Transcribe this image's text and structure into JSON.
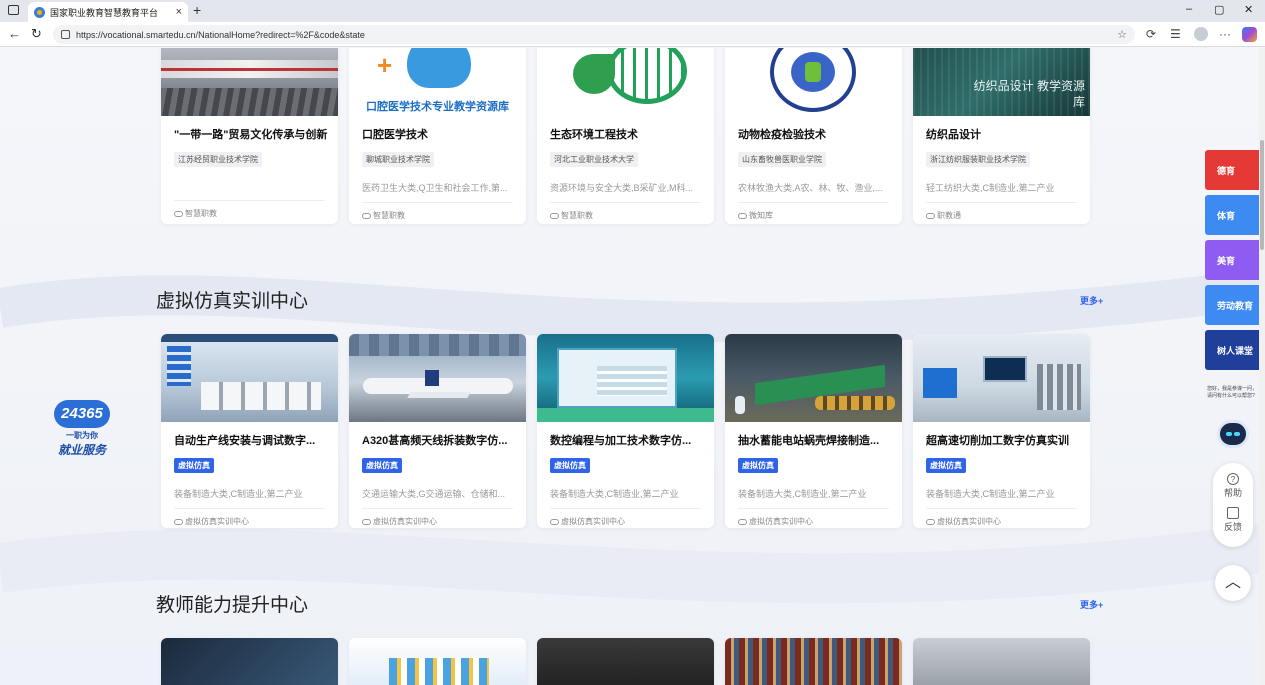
{
  "browser": {
    "tab_title": "国家职业教育智慧教育平台",
    "tab_close": "×",
    "new_tab": "+",
    "url": "https://vocational.smartedu.cn/NationalHome?redirect=%2F&code&state",
    "back": "←",
    "reload": "↻",
    "minimize": "–",
    "maximize": "▢",
    "close": "✕",
    "star": "☆",
    "more": "···"
  },
  "top_cards": [
    {
      "title": "\"一带一路\"贸易文化传承与创新",
      "school": "江苏经贸职业技术学院",
      "category": "",
      "source": "智慧职教"
    },
    {
      "title": "口腔医学技术",
      "school": "聊城职业技术学院",
      "category": "医药卫生大类,Q卫生和社会工作,第...",
      "source": "智慧职教",
      "thumb_text": "口腔医学技术专业教学资源库"
    },
    {
      "title": "生态环境工程技术",
      "school": "河北工业职业技术大学",
      "category": "资源环境与安全大类,B采矿业,M科...",
      "source": "智慧职教"
    },
    {
      "title": "动物检疫检验技术",
      "school": "山东畜牧兽医职业学院",
      "category": "农林牧渔大类,A农、林、牧、渔业,...",
      "source": "微知库"
    },
    {
      "title": "纺织品设计",
      "school": "浙江纺织服装职业技术学院",
      "category": "轻工纺织大类,C制造业,第二产业",
      "source": "职教通",
      "thumb_text": "纺织品设计 教学资源库"
    }
  ],
  "virtual_section": {
    "title": "虚拟仿真实训中心",
    "more": "更多+",
    "cards": [
      {
        "title": "自动生产线安装与调试数字...",
        "badge": "虚拟仿真",
        "category": "装备制造大类,C制造业,第二产业",
        "source": "虚拟仿真实训中心"
      },
      {
        "title": "A320甚高频天线拆装数字仿...",
        "badge": "虚拟仿真",
        "category": "交通运输大类,G交通运输、仓储和...",
        "source": "虚拟仿真实训中心"
      },
      {
        "title": "数控编程与加工技术数字仿...",
        "badge": "虚拟仿真",
        "category": "装备制造大类,C制造业,第二产业",
        "source": "虚拟仿真实训中心"
      },
      {
        "title": "抽水蓄能电站蜗壳焊接制造...",
        "badge": "虚拟仿真",
        "category": "装备制造大类,C制造业,第二产业",
        "source": "虚拟仿真实训中心"
      },
      {
        "title": "超高速切削加工数字仿真实训",
        "badge": "虚拟仿真",
        "category": "装备制造大类,C制造业,第二产业",
        "source": "虚拟仿真实训中心"
      }
    ]
  },
  "teacher_section": {
    "title": "教师能力提升中心",
    "more": "更多+"
  },
  "side_nav": [
    {
      "label": "德育",
      "color": "#e53935"
    },
    {
      "label": "体育",
      "color": "#3d8bf2"
    },
    {
      "label": "美育",
      "color": "#8e5cf0"
    },
    {
      "label": "劳动教育",
      "color": "#3d8bf2"
    },
    {
      "label": "树人课堂",
      "color": "#1f3f9a"
    }
  ],
  "robot_tip": "您好，我是参谋一问，请问有什么可以帮您?",
  "help": "帮助",
  "feedback": "反馈",
  "to_top": "︿",
  "logo": {
    "number": "24365",
    "line1": "一职为你",
    "line2": "就业服务"
  }
}
